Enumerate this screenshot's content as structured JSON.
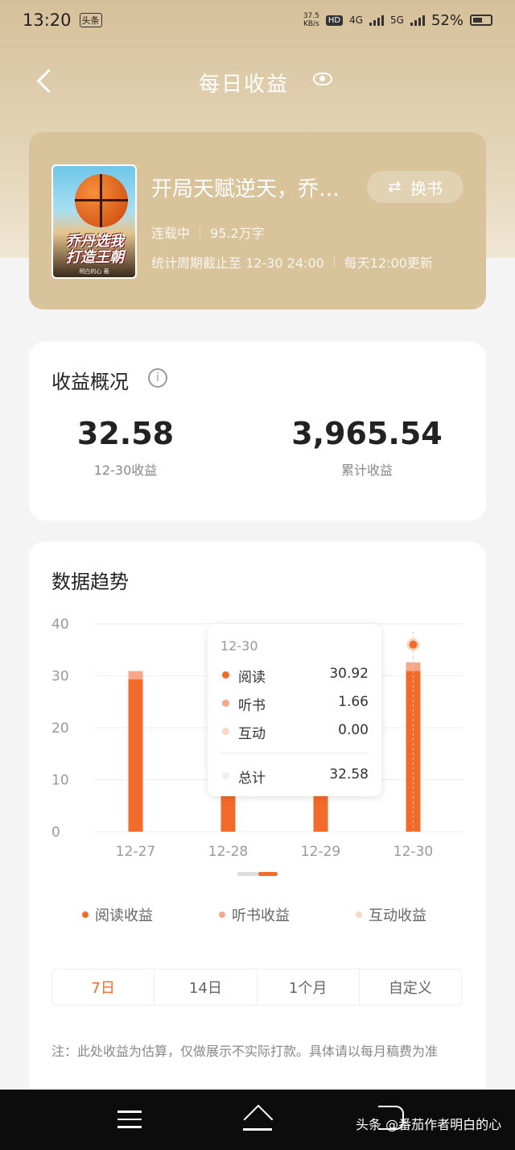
{
  "status": {
    "time": "13:20",
    "app_badge": "头条",
    "speed_value": "37.5",
    "speed_unit": "KB/s",
    "hd_badge": "HD",
    "net_4g": "4G",
    "net_5g": "5G",
    "battery": "52%"
  },
  "nav": {
    "title": "每日收益"
  },
  "book": {
    "title": "开局天赋逆天，乔…",
    "swap_label": "换书",
    "status": "连载中",
    "words": "95.2万字",
    "period": "统计周期截止至 12-30 24:00",
    "update": "每天12:00更新",
    "cover_title": "乔丹选我\n打造王朝",
    "cover_author": "明白的心 著"
  },
  "overview": {
    "title": "收益概况",
    "today_value": "32.58",
    "today_label": "12-30收益",
    "total_value": "3,965.54",
    "total_label": "累计收益"
  },
  "trend": {
    "title": "数据趋势",
    "tooltip": {
      "date": "12-30",
      "rows": [
        {
          "label": "阅读",
          "value": "30.92"
        },
        {
          "label": "听书",
          "value": "1.66"
        },
        {
          "label": "互动",
          "value": "0.00"
        },
        {
          "label": "总计",
          "value": "32.58"
        }
      ]
    },
    "legend": [
      "阅读收益",
      "听书收益",
      "互动收益"
    ],
    "range_tabs": [
      "7日",
      "14日",
      "1个月",
      "自定义"
    ],
    "note": "注：此处收益为估算，仅做展示不实际打款。具体请以每月稿费为准"
  },
  "colors": {
    "read": "#f26b2a",
    "listen": "#f5a98a",
    "interact": "#f9d8c8",
    "total": "#eeeeee"
  },
  "chart_data": {
    "type": "bar",
    "categories": [
      "12-27",
      "12-28",
      "12-29",
      "12-30"
    ],
    "series": [
      {
        "name": "阅读收益",
        "values": [
          29.3,
          8.0,
          8.0,
          30.92
        ]
      },
      {
        "name": "听书收益",
        "values": [
          1.6,
          0,
          0,
          1.66
        ]
      },
      {
        "name": "互动收益",
        "values": [
          0,
          0,
          0,
          0
        ]
      }
    ],
    "stacked": true,
    "ylim": [
      0,
      40
    ],
    "yticks": [
      0,
      10,
      20,
      30,
      40
    ],
    "grid": true,
    "legend": "bottom"
  },
  "footer": {
    "watermark": "头条 @番茄作者明白的心"
  }
}
